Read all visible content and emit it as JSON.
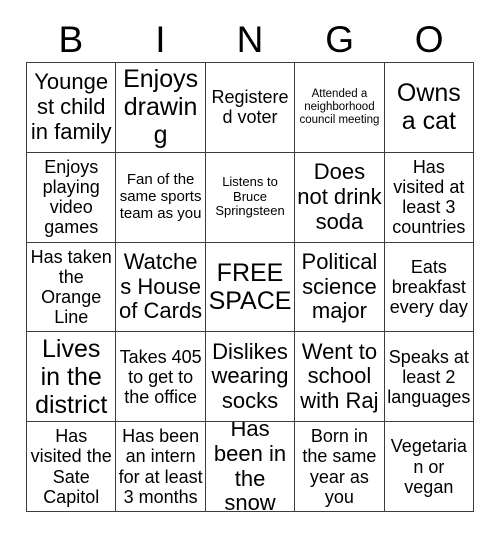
{
  "card": {
    "title_letters": [
      "B",
      "I",
      "N",
      "G",
      "O"
    ],
    "free_space_label": "FREE SPACE",
    "border_color": "#3d3d3d",
    "text_color": "#000000",
    "background_color": "#ffffff",
    "rows": [
      [
        {
          "text": "Youngest child in family",
          "size": "fs-lg"
        },
        {
          "text": "Enjoys drawing",
          "size": "fs-xl"
        },
        {
          "text": "Registered voter",
          "size": "fs-md"
        },
        {
          "text": "Attended a neighborhood council meeting",
          "size": "fs-xxs"
        },
        {
          "text": "Owns a cat",
          "size": "fs-xl"
        }
      ],
      [
        {
          "text": "Enjoys playing video games",
          "size": "fs-md"
        },
        {
          "text": "Fan of the same sports team as you",
          "size": "fs-sm"
        },
        {
          "text": "Listens to Bruce Springsteen",
          "size": "fs-xs"
        },
        {
          "text": "Does not drink soda",
          "size": "fs-lg"
        },
        {
          "text": "Has visited at least 3 countries",
          "size": "fs-md"
        }
      ],
      [
        {
          "text": "Has taken the Orange Line",
          "size": "fs-md"
        },
        {
          "text": "Watches House of Cards",
          "size": "fs-lg"
        },
        {
          "text": "FREE SPACE",
          "size": "fs-xl"
        },
        {
          "text": "Political science major",
          "size": "fs-lg"
        },
        {
          "text": "Eats breakfast every day",
          "size": "fs-md"
        }
      ],
      [
        {
          "text": "Lives in the district",
          "size": "fs-xl"
        },
        {
          "text": "Takes 405 to get to the office",
          "size": "fs-md"
        },
        {
          "text": "Dislikes wearing socks",
          "size": "fs-lg"
        },
        {
          "text": "Went to school with Raj",
          "size": "fs-lg"
        },
        {
          "text": "Speaks at least 2 languages",
          "size": "fs-md"
        }
      ],
      [
        {
          "text": "Has visited the Sate Capitol",
          "size": "fs-md"
        },
        {
          "text": "Has been an intern for at least 3 months",
          "size": "fs-md"
        },
        {
          "text": "Has been in the snow",
          "size": "fs-lg"
        },
        {
          "text": "Born in the same year as you",
          "size": "fs-md"
        },
        {
          "text": "Vegetarian or vegan",
          "size": "fs-md"
        }
      ]
    ]
  }
}
